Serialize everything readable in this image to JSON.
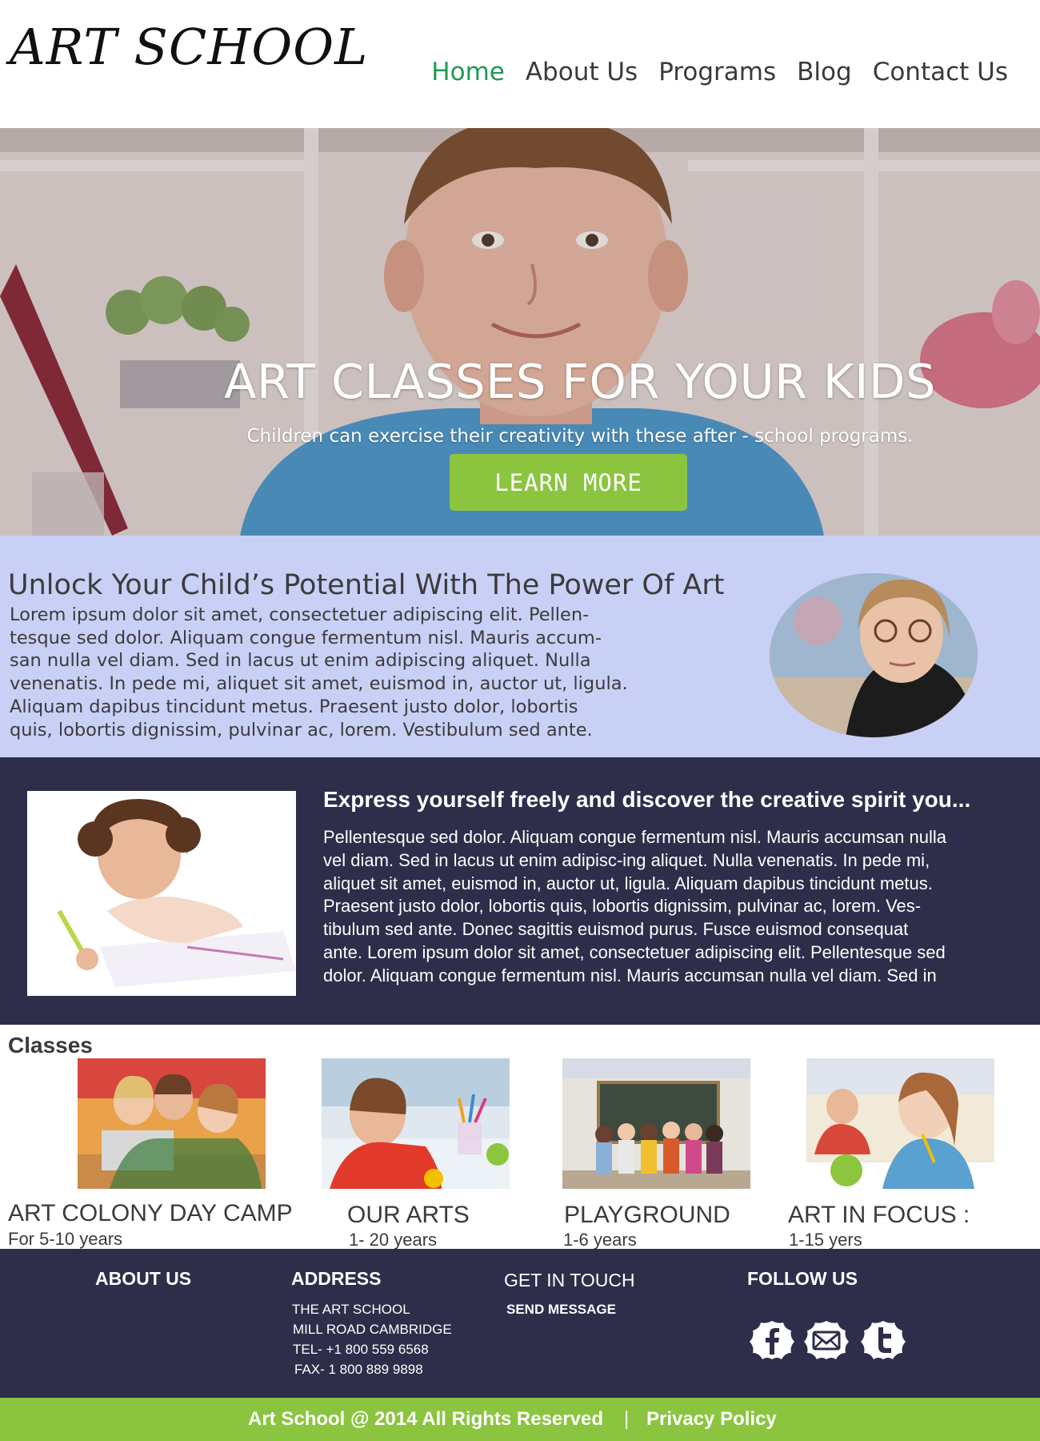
{
  "header": {
    "logo": "ART SCHOOL",
    "nav": [
      {
        "label": "Home",
        "active": true
      },
      {
        "label": "About Us",
        "active": false
      },
      {
        "label": "Programs",
        "active": false
      },
      {
        "label": "Blog",
        "active": false
      },
      {
        "label": "Contact Us",
        "active": false
      }
    ]
  },
  "hero": {
    "title": "ART CLASSES FOR YOUR KIDS",
    "subtitle": "Children can exercise their creativity with these after - school programs.",
    "button_label": "LEARN MORE"
  },
  "unlock": {
    "title": "Unlock Your Child’s Potential With The Power Of Art",
    "lines": [
      "Lorem ipsum dolor sit amet, consectetuer adipiscing elit. Pellen-",
      "tesque sed dolor. Aliquam congue fermentum nisl. Mauris accum-",
      "san nulla vel diam. Sed in lacus ut enim adipiscing aliquet. Nulla",
      "venenatis. In pede mi, aliquet sit amet, euismod in, auctor ut, ligula.",
      "Aliquam dapibus tincidunt metus. Praesent justo dolor, lobortis",
      "quis, lobortis dignissim, pulvinar ac, lorem. Vestibulum sed ante."
    ]
  },
  "express": {
    "title": "Express yourself freely and discover the creative spirit you...",
    "lines": [
      "Pellentesque sed dolor. Aliquam congue fermentum nisl. Mauris accumsan nulla",
      "vel diam. Sed in lacus ut enim adipisc-ing aliquet. Nulla venenatis. In pede mi,",
      "aliquet sit amet, euismod in, auctor ut, ligula. Aliquam dapibus tincidunt metus.",
      "Praesent justo dolor, lobortis quis, lobortis dignissim, pulvinar ac, lorem. Ves-",
      "tibulum sed ante. Donec sagittis euismod purus. Fusce euismod consequat",
      "ante. Lorem ipsum dolor sit amet, consectetuer adipiscing elit. Pellentesque sed",
      "dolor. Aliquam congue fermentum nisl. Mauris accumsan nulla vel diam. Sed in"
    ]
  },
  "classes": {
    "heading": "Classes",
    "items": [
      {
        "title": "ART COLONY DAY CAMP",
        "age": "For 5-10 years"
      },
      {
        "title": "OUR ARTS",
        "age": "1- 20 years"
      },
      {
        "title": "PLAYGROUND",
        "age": "1-6 years"
      },
      {
        "title": "ART IN FOCUS :",
        "age": "1-15 yers"
      }
    ]
  },
  "footer": {
    "about_heading": "ABOUT US",
    "address_heading": "ADDRESS",
    "address_lines": [
      "THE ART SCHOOL",
      "MILL ROAD CAMBRIDGE",
      "TEL- +1 800 559 6568",
      "FAX- 1 800 889 9898"
    ],
    "touch_heading": "GET IN TOUCH",
    "send_message": "SEND MESSAGE",
    "follow_heading": "FOLLOW US",
    "social_icons": [
      "facebook-icon",
      "mail-icon",
      "twitter-icon"
    ],
    "copyright": "Art School @ 2014 All Rights Reserved",
    "separator": "|",
    "privacy": "Privacy Policy"
  },
  "colors": {
    "nav_active": "#1e9b53",
    "accent_green": "#8bc540",
    "dark_navy": "#2e2d4a",
    "unlock_bg": "#c9d0f5"
  }
}
